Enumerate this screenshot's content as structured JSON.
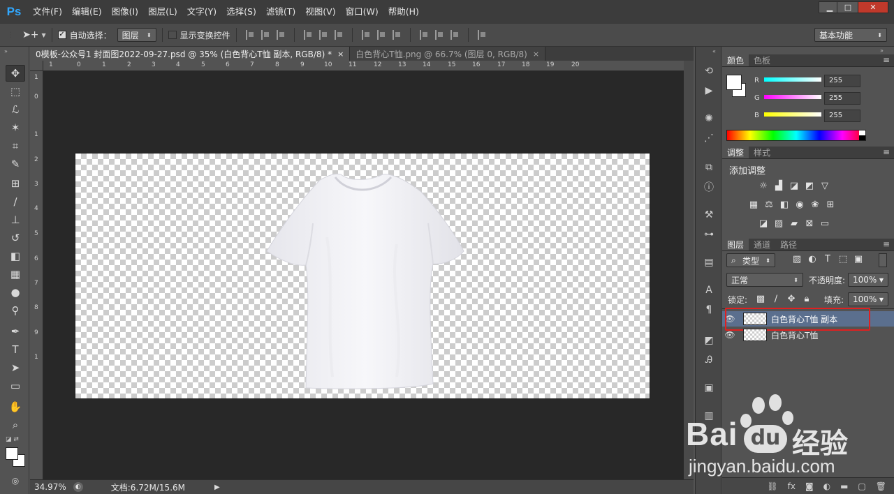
{
  "app": {
    "logo": "Ps"
  },
  "menu": [
    "文件(F)",
    "编辑(E)",
    "图像(I)",
    "图层(L)",
    "文字(Y)",
    "选择(S)",
    "滤镜(T)",
    "视图(V)",
    "窗口(W)",
    "帮助(H)"
  ],
  "window_controls": {
    "minimize": "▁",
    "maximize": "□",
    "close": "✕"
  },
  "options": {
    "auto_select_label": "自动选择：",
    "auto_select_checked": true,
    "auto_select_target": "图层",
    "show_transform_label": "显示变换控件",
    "show_transform_checked": false,
    "workspace": "基本功能"
  },
  "document_tabs": [
    {
      "title": "0模板-公众号1 封面图2022-09-27.psd @ 35% (白色背心T恤 副本, RGB/8) *",
      "active": true,
      "close": "×"
    },
    {
      "title": "白色背心T恤.png @ 66.7% (图层 0, RGB/8)",
      "active": false,
      "close": "×"
    }
  ],
  "ruler": {
    "top": [
      "1",
      "0",
      "1",
      "2",
      "3",
      "4",
      "5",
      "6",
      "7",
      "8",
      "9",
      "10",
      "11",
      "12",
      "13",
      "14",
      "15",
      "16",
      "17",
      "18",
      "19",
      "20"
    ],
    "left": [
      "1",
      "0",
      "1",
      "2",
      "3",
      "4",
      "5",
      "6",
      "7",
      "8",
      "9",
      "1"
    ]
  },
  "status": {
    "zoom": "34.97%",
    "doc_info": "文档:6.72M/15.6M"
  },
  "color_panel": {
    "tabs": [
      "颜色",
      "色板"
    ],
    "r_label": "R",
    "g_label": "G",
    "b_label": "B",
    "r": "255",
    "g": "255",
    "b": "255",
    "foreground": "#ffffff",
    "background": "#ffffff"
  },
  "adjustments_panel": {
    "tabs": [
      "调整",
      "样式"
    ],
    "heading": "添加调整"
  },
  "layers_panel": {
    "tabs": [
      "图层",
      "通道",
      "路径"
    ],
    "filter_kind": "类型",
    "blend_mode": "正常",
    "opacity_label": "不透明度:",
    "opacity": "100%",
    "lock_label": "锁定:",
    "fill_label": "填充:",
    "fill": "100%",
    "layers": [
      {
        "name": "白色背心T恤 副本",
        "visible": true,
        "selected": true
      },
      {
        "name": "白色背心T恤",
        "visible": true,
        "selected": false
      }
    ],
    "highlight_color": "#e02020"
  },
  "watermark": {
    "brand": "Bai",
    "du": "du",
    "jingyan": "经验",
    "url": "jingyan.baidu.com"
  }
}
